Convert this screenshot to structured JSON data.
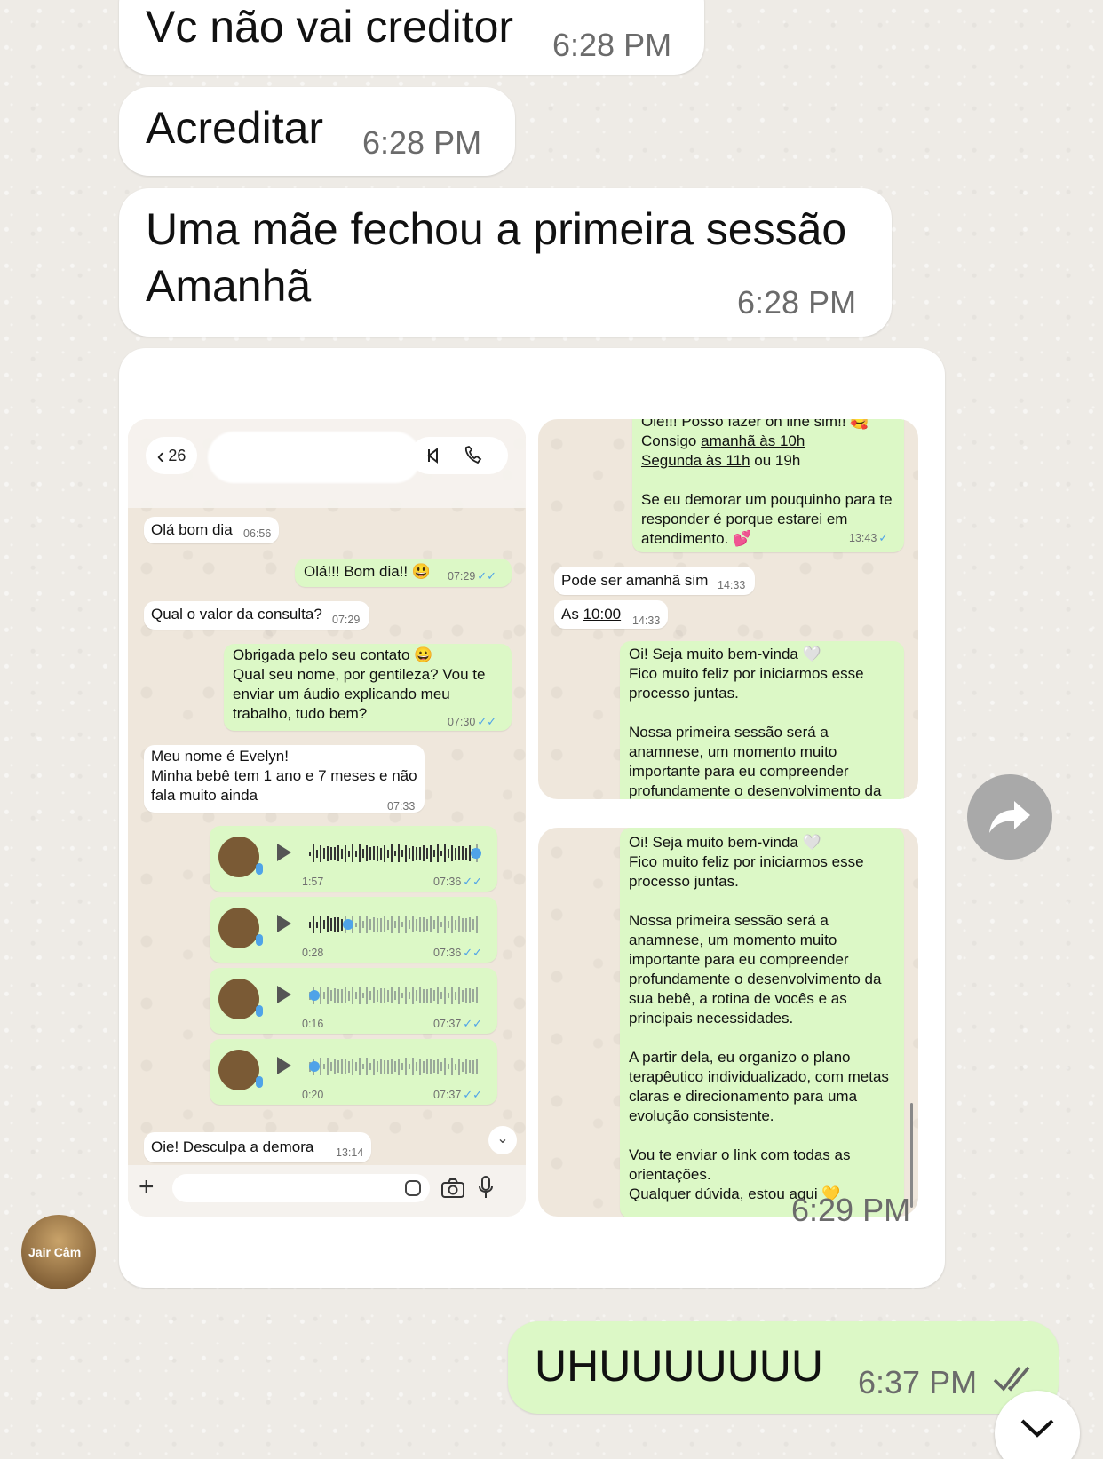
{
  "messages": [
    {
      "text": "Vc não vai creditor",
      "time": "6:28 PM"
    },
    {
      "text": "Acreditar",
      "time": "6:28 PM"
    },
    {
      "text": "Uma mãe fechou a primeira sessão\nAmanhã",
      "time": "6:28 PM"
    },
    {
      "time": "6:29 PM"
    },
    {
      "text": "UHUUUUUUU",
      "time": "6:37 PM"
    }
  ],
  "avatar_text": "Jair Câm",
  "left_shot": {
    "header": {
      "back_count": "26"
    },
    "messages": [
      {
        "text": "Olá bom dia",
        "time": "06:56"
      },
      {
        "text": "Olá!!! Bom dia!! 😃",
        "time": "07:29"
      },
      {
        "text": "Qual o valor da consulta?",
        "time": "07:29"
      },
      {
        "text": "Obrigada pelo seu contato 😀\nQual seu nome, por gentileza? Vou te\nenviar um áudio explicando meu\ntrabalho, tudo bem?",
        "time": "07:30"
      },
      {
        "text": "Meu nome é Evelyn!\nMinha bebê tem 1 ano e 7 meses e não\nfala muito ainda",
        "time": "07:33"
      },
      {
        "text": "Oie! Desculpa a demora",
        "time": "13:14"
      }
    ],
    "voice_notes": [
      {
        "duration": "1:57",
        "time": "07:36",
        "progress": 0.97
      },
      {
        "duration": "0:28",
        "time": "07:36",
        "progress": 0.2
      },
      {
        "duration": "0:16",
        "time": "07:37",
        "progress": 0.0
      },
      {
        "duration": "0:20",
        "time": "07:37",
        "progress": 0.0
      }
    ],
    "avatar_text": "Jair Câm"
  },
  "right_shot_top": {
    "partial_line": "Oie!!! Posso fazer on line sim!! 🥰",
    "msg1": {
      "line1_pre": "Consigo ",
      "line1_link": "amanhã às 10h",
      "line2_link": "Segunda às 11h",
      "line2_post": " ou 19h",
      "rest": "Se eu demorar um pouquinho para te\nresponder é porque estarei em\natendimento. 💕",
      "time": "13:43"
    },
    "msg2": {
      "text": "Pode ser amanhã sim",
      "time": "14:33"
    },
    "msg3": {
      "pre": "As ",
      "link": "10:00",
      "time": "14:33"
    },
    "msg4": {
      "text": "Oi! Seja muito bem-vinda 🤍\nFico muito feliz por iniciarmos esse\nprocesso juntas.\n\nNossa primeira sessão será a\nanamnese, um momento muito\nimportante para eu compreender\nprofundamente o desenvolvimento da"
    }
  },
  "right_shot_bottom": {
    "text": "Oi! Seja muito bem-vinda 🤍\nFico muito feliz por iniciarmos esse\nprocesso juntas.\n\nNossa primeira sessão será a\nanamnese, um momento muito\nimportante para eu compreender\nprofundamente o desenvolvimento da\nsua bebê, a rotina de vocês e as\nprincipais necessidades.\n\nA partir dela, eu organizo o plano\nterapêutico individualizado, com metas\nclaras e direcionamento para uma\nevolução consistente.\n\nVou te enviar o link com todas as\norientações.\nQualquer dúvida, estou aqui 💛"
  },
  "colors": {
    "incoming": "#ffffff",
    "outgoing": "#dcf8c6",
    "read_ticks": "#4fa3e8"
  },
  "icons": [
    "forward-icon",
    "scroll-down-chevron-icon",
    "double-check-icon",
    "plus-icon",
    "sticker-icon",
    "camera-icon",
    "mic-icon",
    "phone-icon",
    "video-call-icon",
    "back-chevron-icon",
    "play-icon"
  ]
}
